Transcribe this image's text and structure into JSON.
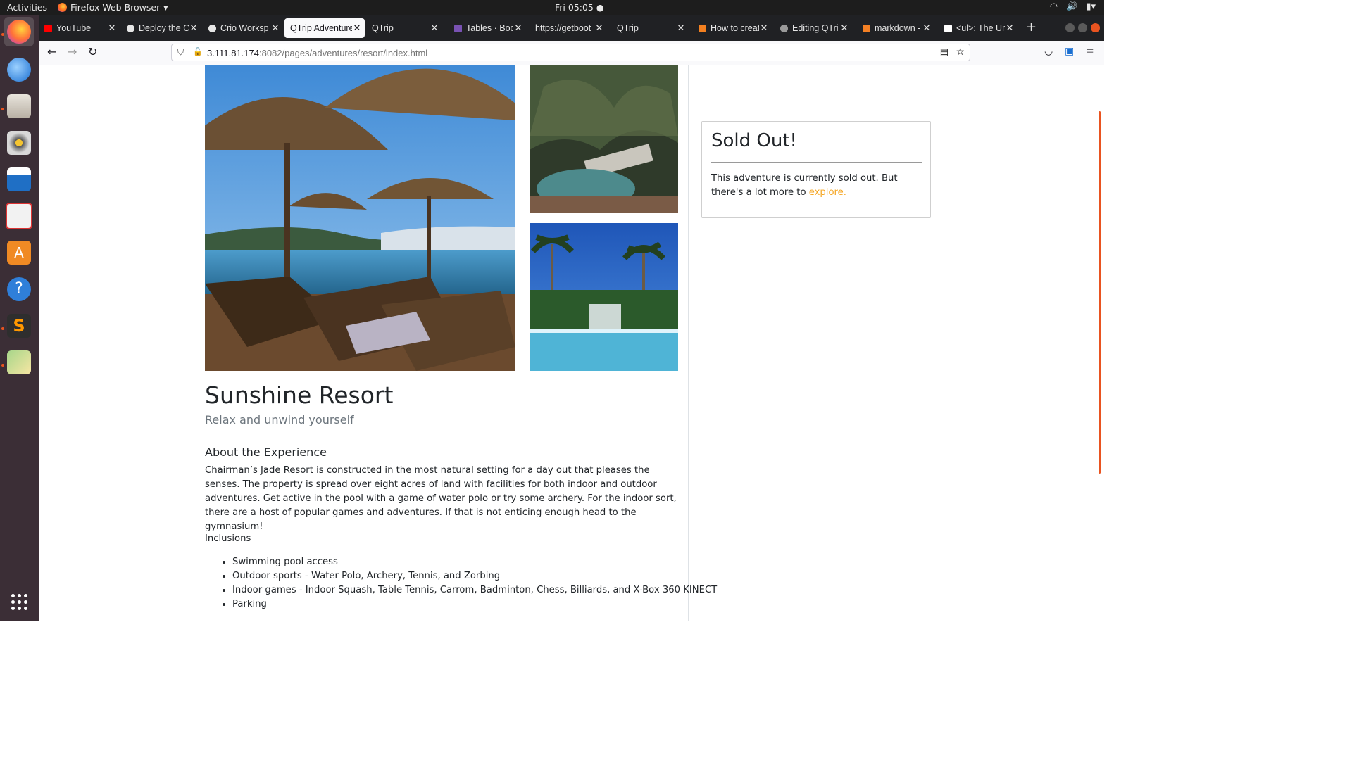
{
  "system_bar": {
    "activities": "Activities",
    "app_name": "Firefox Web Browser",
    "clock": "Fri 05:05"
  },
  "tabs": [
    {
      "title": "YouTube",
      "favicon_color": "#ff0000"
    },
    {
      "title": "Deploy the C",
      "favicon_color": "#e6e6e6"
    },
    {
      "title": "Crio Worksp",
      "favicon_color": "#e6e6e6"
    },
    {
      "title": "QTrip Adventure",
      "favicon_color": "",
      "active": true
    },
    {
      "title": "QTrip",
      "favicon_color": ""
    },
    {
      "title": "Tables · Boot",
      "favicon_color": "#7952b3"
    },
    {
      "title": "https://getboot",
      "favicon_color": ""
    },
    {
      "title": "QTrip",
      "favicon_color": ""
    },
    {
      "title": "How to creat",
      "favicon_color": "#f38020"
    },
    {
      "title": "Editing QTrip",
      "favicon_color": "#9a9a9a"
    },
    {
      "title": "markdown - I",
      "favicon_color": "#f48024"
    },
    {
      "title": "<ul>: The Un",
      "favicon_color": "#ffffff"
    }
  ],
  "address_bar": {
    "host": "3.111.81.174",
    "path": ":8082/pages/adventures/resort/index.html"
  },
  "adventure": {
    "title": "Sunshine Resort",
    "subtitle": "Relax and unwind yourself",
    "about_heading": "About the Experience",
    "about_text": "Chairman’s Jade Resort is constructed in the most natural setting for a day out that pleases the senses. The property is spread over eight acres of land with facilities for both indoor and outdoor adventures. Get active in the pool with a game of water polo or try some archery. For the indoor sort, there are a host of popular games and adventures. If that is not enticing enough head to the gymnasium!",
    "inclusions_heading": "Inclusions",
    "inclusions": [
      "Swimming pool access",
      "Outdoor sports - Water Polo, Archery, Tennis, and Zorbing",
      "Indoor games - Indoor Squash, Table Tennis, Carrom, Badminton, Chess, Billiards, and X-Box 360 KINECT",
      "Parking"
    ]
  },
  "sold_out": {
    "title": "Sold Out!",
    "text": "This adventure is currently sold out. But there's a lot more to ",
    "link": "explore."
  },
  "colors": {
    "link": "#f5a623",
    "dock_bg": "#3b2e36",
    "tab_strip": "#202124",
    "accent": "#e95420"
  }
}
